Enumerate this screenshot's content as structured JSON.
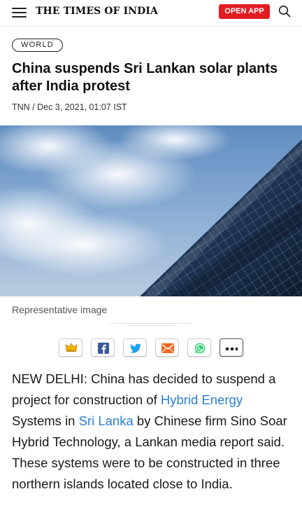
{
  "header": {
    "logo_text": "THE TIMES OF INDIA",
    "open_app_label": "OPEN APP",
    "brand_color": "#e21b22",
    "icons": {
      "menu": "hamburger-menu-icon",
      "search": "search-icon"
    }
  },
  "article": {
    "section": "WORLD",
    "title": "China suspends Sri Lankan solar plants after India protest",
    "byline": "TNN / Dec 3, 2021, 01:07 IST",
    "image_caption": "Representative image",
    "body": {
      "part1": "NEW DELHI: China has decided to suspend a project for construction of ",
      "link1": "Hybrid Energy",
      "part2": " Systems in ",
      "link2": "Sri Lanka",
      "part3": " by Chinese firm Sino Soar Hybrid Technology, a Lankan media report said. These systems were to be constructed in three northern islands located close to India."
    },
    "link_color": "#2a7fd6"
  },
  "share_bar": {
    "icons": [
      "crown-icon",
      "facebook-icon",
      "twitter-icon",
      "email-icon",
      "whatsapp-icon",
      "more-icon"
    ]
  }
}
